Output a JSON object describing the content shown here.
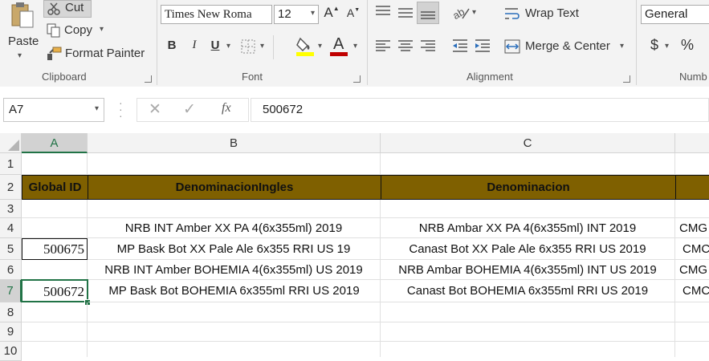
{
  "clipboard": {
    "paste": "Paste",
    "cut": "Cut",
    "copy": "Copy",
    "format_painter": "Format Painter",
    "label": "Clipboard"
  },
  "font": {
    "name": "Times New Roma",
    "size": "12",
    "bold": "B",
    "italic": "I",
    "underline": "U",
    "font_color": "A",
    "grow": "A",
    "shrink": "A",
    "label": "Font"
  },
  "alignment": {
    "wrap_text": "Wrap Text",
    "merge_center": "Merge & Center",
    "label": "Alignment"
  },
  "number": {
    "format": "General",
    "currency": "$",
    "percent": "%",
    "label": "Numb"
  },
  "formula_bar": {
    "name_box": "A7",
    "fx": "fx",
    "value": "500672"
  },
  "columns": [
    "A",
    "B",
    "C"
  ],
  "rows": [
    "1",
    "2",
    "3",
    "4",
    "5",
    "6",
    "7",
    "8",
    "9",
    "10"
  ],
  "headers": {
    "a": "Global ID",
    "b": "DenominacionIngles",
    "c": "Denominacion"
  },
  "data_rows": [
    {
      "a": "",
      "b": "NRB INT Amber XX PA 4(6x355ml) 2019",
      "c": "NRB Ambar XX PA 4(6x355ml) INT 2019",
      "d": "CMG"
    },
    {
      "a": "500675",
      "b": "MP Bask Bot XX Pale Ale 6x355 RRI US 19",
      "c": "Canast Bot XX Pale Ale 6x355 RRI US 2019",
      "d": "CMC"
    },
    {
      "a": "",
      "b": "NRB INT Amber BOHEMIA 4(6x355ml) US 2019",
      "c": "NRB Ambar BOHEMIA 4(6x355ml) INT US 2019",
      "d": "CMG"
    },
    {
      "a": "500672",
      "b": "MP Bask Bot BOHEMIA 6x355ml RRI US 2019",
      "c": "Canast Bot BOHEMIA 6x355ml RRI US 2019",
      "d": "CMC"
    }
  ],
  "colors": {
    "header_fill": "#7f6000",
    "highlight_fill": "#ffff00",
    "font_color": "#c00000",
    "selection": "#217346"
  }
}
